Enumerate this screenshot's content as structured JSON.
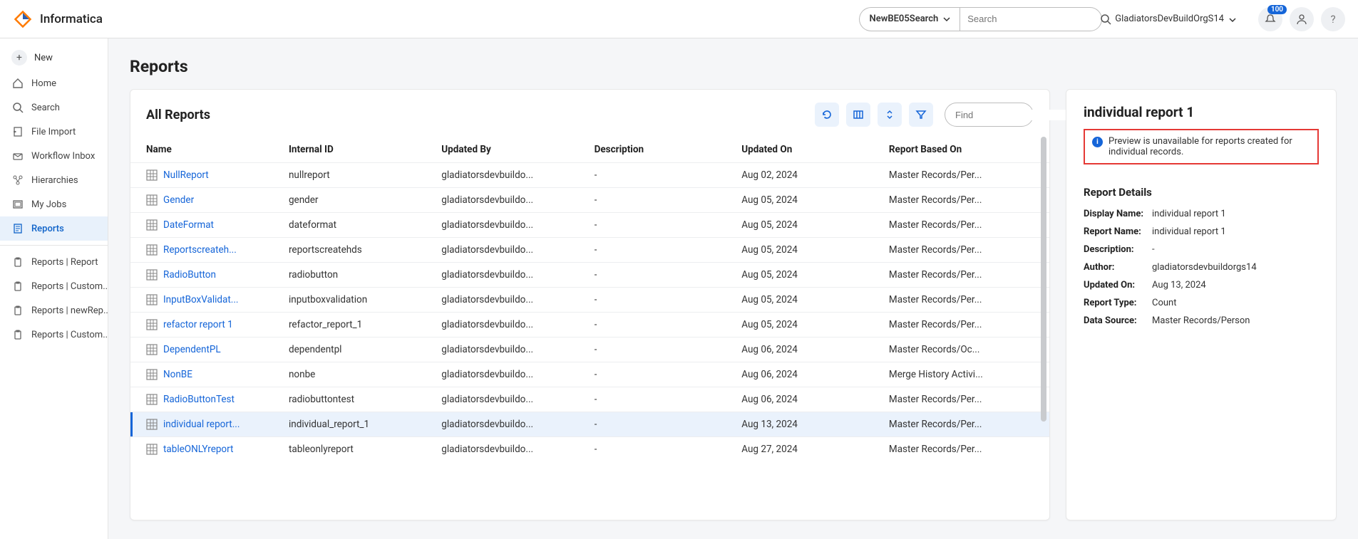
{
  "brand": {
    "name": "Informatica"
  },
  "header": {
    "search_scope": "NewBE05Search",
    "search_placeholder": "Search",
    "org_name": "GladiatorsDevBuildOrgS14",
    "notification_badge": "100"
  },
  "sidebar": {
    "new_label": "New",
    "items": [
      {
        "label": "Home",
        "icon": "home"
      },
      {
        "label": "Search",
        "icon": "search"
      },
      {
        "label": "File Import",
        "icon": "import"
      },
      {
        "label": "Workflow Inbox",
        "icon": "inbox"
      },
      {
        "label": "Hierarchies",
        "icon": "hierarchy"
      },
      {
        "label": "My Jobs",
        "icon": "jobs"
      },
      {
        "label": "Reports",
        "icon": "reports",
        "selected": true
      }
    ],
    "sub_items": [
      {
        "label": "Reports | Report"
      },
      {
        "label": "Reports | Custom..."
      },
      {
        "label": "Reports | newRep..."
      },
      {
        "label": "Reports | Custom..."
      }
    ]
  },
  "page": {
    "title": "Reports"
  },
  "reports": {
    "panel_title": "All Reports",
    "find_placeholder": "Find",
    "columns": [
      "Name",
      "Internal ID",
      "Updated By",
      "Description",
      "Updated On",
      "Report Based On"
    ],
    "rows": [
      {
        "name": "NullReport",
        "internal": "nullreport",
        "updatedBy": "gladiatorsdevbuildo...",
        "desc": "-",
        "updatedOn": "Aug 02, 2024",
        "basedOn": "Master Records/Per..."
      },
      {
        "name": "Gender",
        "internal": "gender",
        "updatedBy": "gladiatorsdevbuildo...",
        "desc": "-",
        "updatedOn": "Aug 05, 2024",
        "basedOn": "Master Records/Per..."
      },
      {
        "name": "DateFormat",
        "internal": "dateformat",
        "updatedBy": "gladiatorsdevbuildo...",
        "desc": "-",
        "updatedOn": "Aug 05, 2024",
        "basedOn": "Master Records/Per..."
      },
      {
        "name": "Reportscreateh...",
        "internal": "reportscreatehds",
        "updatedBy": "gladiatorsdevbuildo...",
        "desc": "-",
        "updatedOn": "Aug 05, 2024",
        "basedOn": "Master Records/Per..."
      },
      {
        "name": "RadioButton",
        "internal": "radiobutton",
        "updatedBy": "gladiatorsdevbuildo...",
        "desc": "-",
        "updatedOn": "Aug 05, 2024",
        "basedOn": "Master Records/Per..."
      },
      {
        "name": "InputBoxValidat...",
        "internal": "inputboxvalidation",
        "updatedBy": "gladiatorsdevbuildo...",
        "desc": "-",
        "updatedOn": "Aug 05, 2024",
        "basedOn": "Master Records/Per..."
      },
      {
        "name": "refactor report 1",
        "internal": "refactor_report_1",
        "updatedBy": "gladiatorsdevbuildo...",
        "desc": "-",
        "updatedOn": "Aug 05, 2024",
        "basedOn": "Master Records/Per..."
      },
      {
        "name": "DependentPL",
        "internal": "dependentpl",
        "updatedBy": "gladiatorsdevbuildo...",
        "desc": "-",
        "updatedOn": "Aug 06, 2024",
        "basedOn": "Master Records/Oc..."
      },
      {
        "name": "NonBE",
        "internal": "nonbe",
        "updatedBy": "gladiatorsdevbuildo...",
        "desc": "-",
        "updatedOn": "Aug 06, 2024",
        "basedOn": "Merge History Activi..."
      },
      {
        "name": "RadioButtonTest",
        "internal": "radiobuttontest",
        "updatedBy": "gladiatorsdevbuildo...",
        "desc": "-",
        "updatedOn": "Aug 06, 2024",
        "basedOn": "Master Records/Per..."
      },
      {
        "name": "individual report...",
        "internal": "individual_report_1",
        "updatedBy": "gladiatorsdevbuildo...",
        "desc": "-",
        "updatedOn": "Aug 13, 2024",
        "basedOn": "Master Records/Per...",
        "selected": true
      },
      {
        "name": "tableONLYreport",
        "internal": "tableonlyreport",
        "updatedBy": "gladiatorsdevbuildo...",
        "desc": "-",
        "updatedOn": "Aug 27, 2024",
        "basedOn": "Master Records/Per..."
      }
    ]
  },
  "detail": {
    "title": "individual report 1",
    "callout": "Preview is unavailable for reports created for individual records.",
    "section_title": "Report Details",
    "fields": [
      {
        "label": "Display Name:",
        "value": "individual report 1"
      },
      {
        "label": "Report Name:",
        "value": "individual report 1"
      },
      {
        "label": "Description:",
        "value": "-"
      },
      {
        "label": "Author:",
        "value": "gladiatorsdevbuildorgs14"
      },
      {
        "label": "Updated On:",
        "value": "Aug 13, 2024"
      },
      {
        "label": "Report Type:",
        "value": "Count"
      },
      {
        "label": "Data Source:",
        "value": "Master Records/Person"
      }
    ]
  }
}
